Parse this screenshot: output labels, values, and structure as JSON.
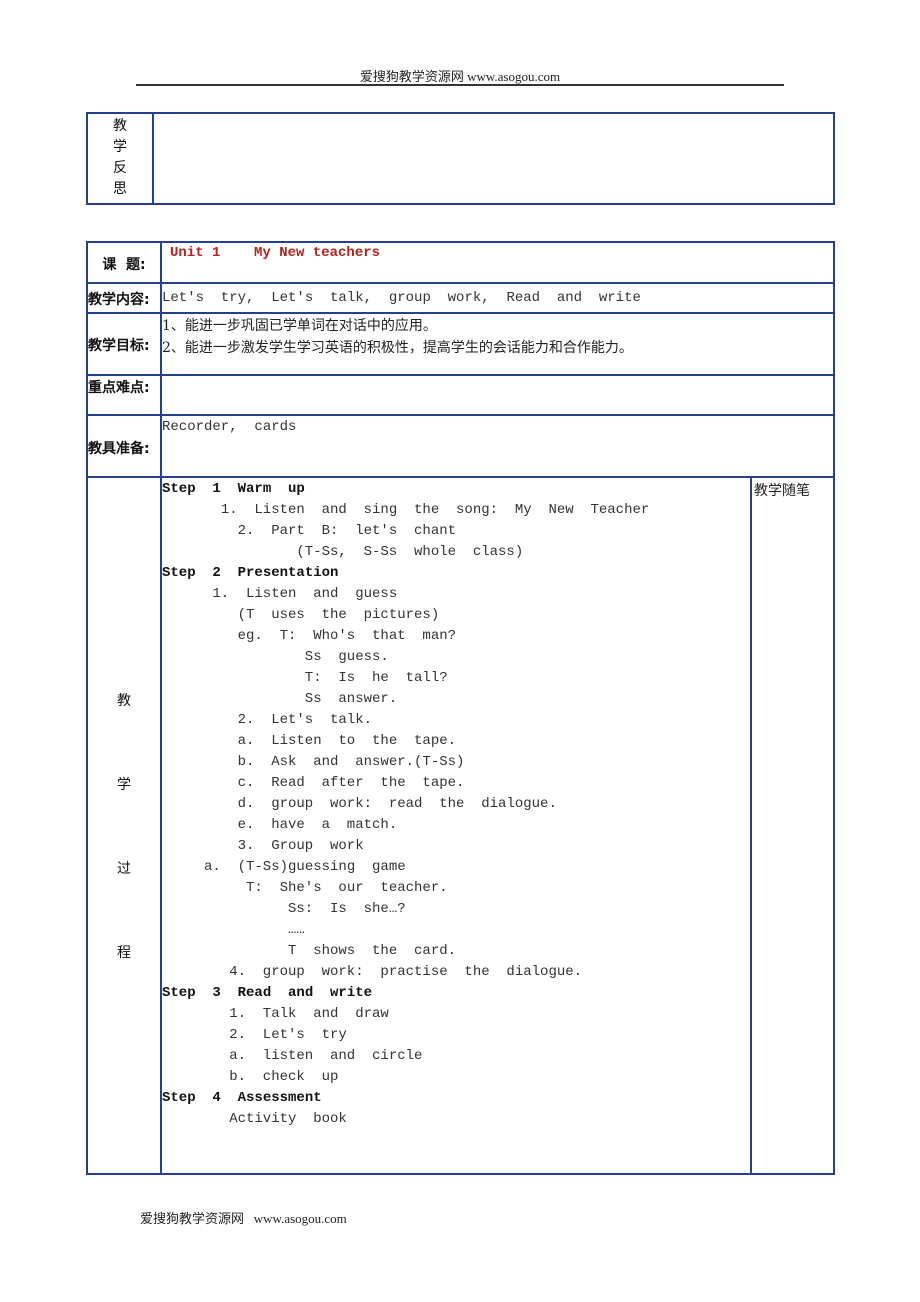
{
  "header": {
    "site_name": "爱搜狗教学资源网  www.asogou.com"
  },
  "reflection_table": {
    "label_chars": [
      "教",
      "学",
      "反",
      "思"
    ],
    "content": ""
  },
  "lesson_table": {
    "topic": {
      "label": "课  题:",
      "value": "Unit 1    My New teachers"
    },
    "content": {
      "label": "教学内容:",
      "value": "Let's  try,  Let's  talk,  group  work,  Read  and  write"
    },
    "objectives": {
      "label": "教学目标:",
      "items": [
        "1、能进一步巩固已学单词在对话中的应用。",
        "2、能进一步激发学生学习英语的积极性，提高学生的会话能力和合作能力。"
      ]
    },
    "key_points": {
      "label": "重点难点:",
      "value": ""
    },
    "materials": {
      "label": "教具准备:",
      "value": "Recorder,  cards"
    },
    "process": {
      "label_chars": [
        "教",
        "学",
        "过",
        "程"
      ],
      "notes_label": "教学随笔",
      "lines": [
        {
          "text": "Step  1  Warm  up",
          "bold": true,
          "indent": 0
        },
        {
          "text": "1.  Listen  and  sing  the  song:  My  New  Teacher",
          "bold": false,
          "indent": 7
        },
        {
          "text": "2.  Part  B:  let's  chant",
          "bold": false,
          "indent": 9
        },
        {
          "text": "(T-Ss,  S-Ss  whole  class)",
          "bold": false,
          "indent": 16
        },
        {
          "text": "Step  2  Presentation",
          "bold": true,
          "indent": 0
        },
        {
          "text": "1.  Listen  and  guess",
          "bold": false,
          "indent": 6
        },
        {
          "text": "(T  uses  the  pictures)",
          "bold": false,
          "indent": 9
        },
        {
          "text": "eg.  T:  Who's  that  man?",
          "bold": false,
          "indent": 9
        },
        {
          "text": "Ss  guess.",
          "bold": false,
          "indent": 17
        },
        {
          "text": "T:  Is  he  tall?",
          "bold": false,
          "indent": 17
        },
        {
          "text": "Ss  answer.",
          "bold": false,
          "indent": 17
        },
        {
          "text": "2.  Let's  talk.",
          "bold": false,
          "indent": 9
        },
        {
          "text": "a.  Listen  to  the  tape.",
          "bold": false,
          "indent": 9
        },
        {
          "text": "b.  Ask  and  answer.(T-Ss)",
          "bold": false,
          "indent": 9
        },
        {
          "text": "c.  Read  after  the  tape.",
          "bold": false,
          "indent": 9
        },
        {
          "text": "d.  group  work:  read  the  dialogue.",
          "bold": false,
          "indent": 9
        },
        {
          "text": "e.  have  a  match.",
          "bold": false,
          "indent": 9
        },
        {
          "text": "3.  Group  work",
          "bold": false,
          "indent": 9
        },
        {
          "text": "a.  (T-Ss)guessing  game",
          "bold": false,
          "indent": 5
        },
        {
          "text": "T:  She's  our  teacher.",
          "bold": false,
          "indent": 10
        },
        {
          "text": "Ss:  Is  she…?",
          "bold": false,
          "indent": 15
        },
        {
          "text": "……",
          "bold": false,
          "indent": 15
        },
        {
          "text": "T  shows  the  card.",
          "bold": false,
          "indent": 15
        },
        {
          "text": "4.  group  work:  practise  the  dialogue.",
          "bold": false,
          "indent": 8
        },
        {
          "text": "Step  3  Read  and  write",
          "bold": true,
          "indent": 0
        },
        {
          "text": "1.  Talk  and  draw",
          "bold": false,
          "indent": 8
        },
        {
          "text": "2.  Let's  try",
          "bold": false,
          "indent": 8
        },
        {
          "text": "a.  listen  and  circle",
          "bold": false,
          "indent": 8
        },
        {
          "text": "b.  check  up",
          "bold": false,
          "indent": 8
        },
        {
          "text": "Step  4  Assessment",
          "bold": true,
          "indent": 0
        },
        {
          "text": "Activity  book",
          "bold": false,
          "indent": 8
        }
      ]
    }
  },
  "footer": {
    "site_name": "爱搜狗教学资源网   www.asogou.com"
  },
  "colors": {
    "table_border": "#25408f",
    "topic_text": "#b22222"
  }
}
